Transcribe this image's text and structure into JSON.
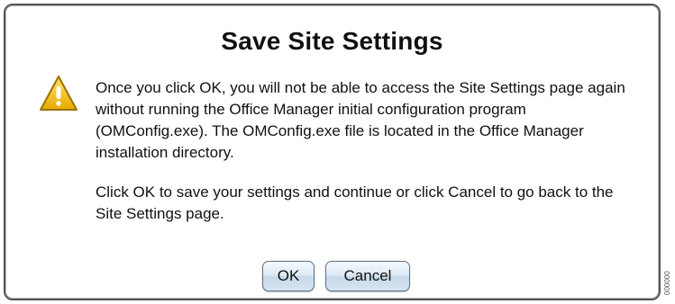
{
  "dialog": {
    "title": "Save Site Settings",
    "warning_icon": "warning-triangle-icon",
    "paragraph_1": "Once you click OK, you will not be able to access the Site Settings page again without running the Office Manager initial configuration program (OMConfig.exe). The OMConfig.exe file is located in the Office Manager installation directory.",
    "paragraph_2": "Click OK to save your settings and continue or click Cancel to go back to the Site Settings page.",
    "ok_label": "OK",
    "cancel_label": "Cancel"
  },
  "side_label": "000000",
  "colors": {
    "warning_fill": "#f4c21b",
    "button_border": "#5b7188",
    "dialog_border": "#555555"
  }
}
